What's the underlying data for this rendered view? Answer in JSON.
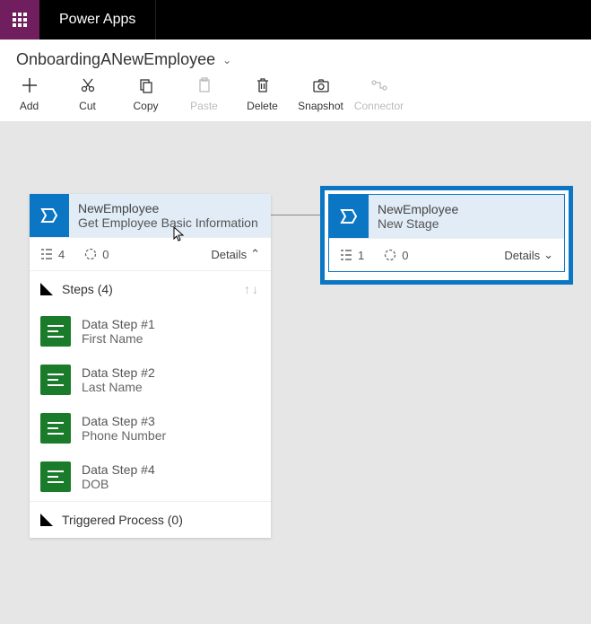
{
  "header": {
    "app_title": "Power Apps"
  },
  "process": {
    "name": "OnboardingANewEmployee"
  },
  "toolbar": {
    "add": "Add",
    "cut": "Cut",
    "copy": "Copy",
    "paste": "Paste",
    "delete": "Delete",
    "snapshot": "Snapshot",
    "connector": "Connector"
  },
  "stage1": {
    "entity": "NewEmployee",
    "name": "Get Employee Basic Information",
    "steps_count": "4",
    "duration": "0",
    "details": "Details",
    "section_steps": "Steps (4)",
    "steps": [
      {
        "title": "Data Step #1",
        "field": "First Name"
      },
      {
        "title": "Data Step #2",
        "field": "Last Name"
      },
      {
        "title": "Data Step #3",
        "field": "Phone Number"
      },
      {
        "title": "Data Step #4",
        "field": "DOB"
      }
    ],
    "triggered": "Triggered Process (0)"
  },
  "stage2": {
    "entity": "NewEmployee",
    "name": "New Stage",
    "steps_count": "1",
    "duration": "0",
    "details": "Details"
  }
}
